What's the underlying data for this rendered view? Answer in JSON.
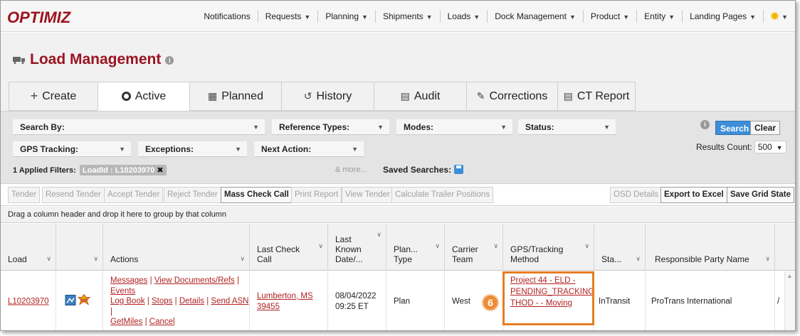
{
  "app": {
    "logo": "OPTIMIZ"
  },
  "nav": {
    "items": [
      {
        "label": "Notifications",
        "caret": ""
      },
      {
        "label": "Requests",
        "caret": "▼"
      },
      {
        "label": "Planning",
        "caret": "▼"
      },
      {
        "label": "Shipments",
        "caret": "▼"
      },
      {
        "label": "Loads",
        "caret": "▼"
      },
      {
        "label": "Dock Management",
        "caret": "▼"
      },
      {
        "label": "Product",
        "caret": "▼"
      },
      {
        "label": "Entity",
        "caret": "▼"
      },
      {
        "label": "Landing Pages",
        "caret": "▼"
      }
    ],
    "settings_caret": "▼"
  },
  "page": {
    "title": "Load Management",
    "info": "i"
  },
  "tabs": [
    {
      "label": "Create",
      "icon": "+"
    },
    {
      "label": "Active",
      "icon": "circle"
    },
    {
      "label": "Planned",
      "icon": "▦"
    },
    {
      "label": "History",
      "icon": "↺"
    },
    {
      "label": "Audit",
      "icon": "▤"
    },
    {
      "label": "Corrections",
      "icon": "✎"
    },
    {
      "label": "CT Report",
      "icon": "▤"
    }
  ],
  "filters": {
    "search_by": "Search By:",
    "reference_types": "Reference Types:",
    "modes": "Modes:",
    "status": "Status:",
    "gps_tracking": "GPS Tracking:",
    "exceptions": "Exceptions:",
    "next_action": "Next Action:",
    "applied_label": "1 Applied Filters:",
    "applied_chip": "LoadId : L10203970",
    "more": "& more...",
    "saved_searches": "Saved Searches:",
    "search_button": "Search",
    "clear_button": "Clear",
    "results_label": "Results Count:",
    "results_value": "500"
  },
  "toolbar": {
    "tender": "Tender",
    "resend_tender": "Resend Tender",
    "accept_tender": "Accept Tender",
    "reject_tender": "Reject Tender",
    "mass_check_call": "Mass Check Call",
    "print_report": "Print Report",
    "view_tender": "View Tender",
    "calculate_trailer": "Calculate Trailer Positions",
    "osd_details": "OSD Details",
    "export_excel": "Export to Excel",
    "save_grid": "Save Grid State"
  },
  "group_hint": "Drag a column header and drop it here to group by that column",
  "grid": {
    "columns": {
      "load": "Load",
      "actions": "Actions",
      "last_check_call": [
        "Last Check",
        "Call"
      ],
      "last_known": [
        "Last",
        "Known",
        "Date/..."
      ],
      "plan_type": [
        "Plan...",
        "Type"
      ],
      "carrier_team": [
        "Carrier",
        "Team"
      ],
      "gps_method": [
        "GPS/Tracking",
        "Method"
      ],
      "status": "Sta...",
      "responsible": "Responsible Party Name"
    },
    "row": {
      "load": "L10203970",
      "actions": {
        "messages": "Messages",
        "view_docs": "View Documents/Refs",
        "events": "Events",
        "log_book": "Log Book",
        "stops": "Stops",
        "details": "Details",
        "send_asn": "Send ASN",
        "get_miles": "GetMiles",
        "cancel": "Cancel"
      },
      "last_check": [
        "Lumberton, MS",
        "39455"
      ],
      "last_known": [
        "08/04/2022",
        "09:25 ET"
      ],
      "plan_type": "Plan",
      "carrier_team": "West",
      "gps_method": [
        "Project 44 - ELD -",
        "PENDING_TRACKING",
        "THOD - - Moving"
      ],
      "status": "InTransit",
      "responsible": "ProTrans International",
      "overflow": "/"
    }
  },
  "callout": {
    "step": "6",
    "color": "#e67e22"
  },
  "colors": {
    "brand": "#9b1320",
    "link": "#b22222",
    "primary": "#3d8ed8"
  }
}
